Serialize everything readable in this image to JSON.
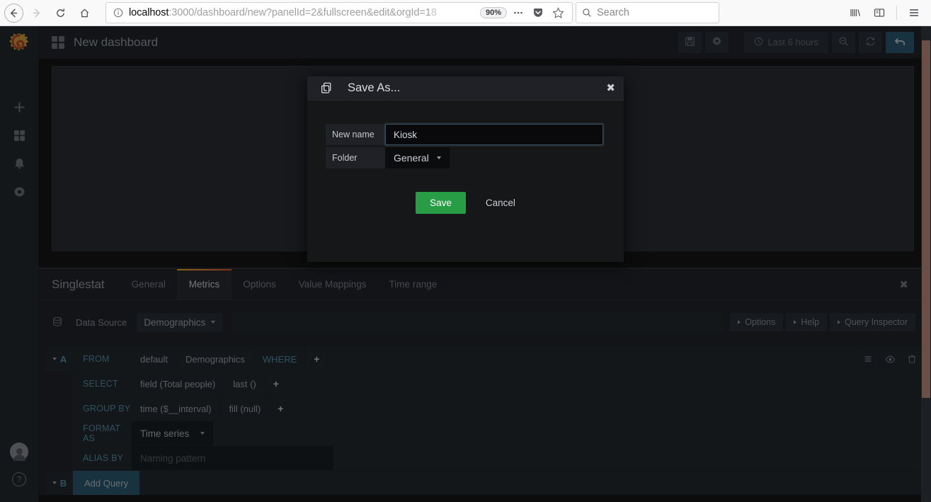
{
  "browser": {
    "nav": {
      "back": "back-arrow",
      "forward": "forward-arrow",
      "reload": "reload",
      "home": "home"
    },
    "url": {
      "host": "localhost",
      "path": ":3000/dashboard/new?panelId=2&fullscreen&edit&orgId=1",
      "faded_tail": "8",
      "info_icon": "info-circle-icon"
    },
    "zoom_level": "90%",
    "search": {
      "placeholder": "Search",
      "icon": "search-icon"
    },
    "icons": {
      "more": "ellipsis-icon",
      "pocket": "pocket-icon",
      "bookmark": "star-icon",
      "library": "library-icon",
      "sidebar": "sidebar-icon",
      "menu": "hamburger-menu-icon"
    }
  },
  "sidebar": {
    "brand": "grafana-logo",
    "items": [
      {
        "name": "create",
        "icon": "plus-icon"
      },
      {
        "name": "dashboards",
        "icon": "apps-grid-icon"
      },
      {
        "name": "alerting",
        "icon": "bell-icon"
      },
      {
        "name": "configuration",
        "icon": "gear-icon"
      }
    ],
    "bottom": [
      {
        "name": "user-profile",
        "icon": "avatar-icon"
      },
      {
        "name": "help",
        "icon": "question-mark-icon"
      }
    ]
  },
  "topnav": {
    "grid_icon": "apps-grid-icon",
    "title": "New dashboard",
    "buttons": [
      {
        "name": "save-dashboard",
        "icon": "floppy-disk-icon",
        "label": ""
      },
      {
        "name": "dashboard-settings",
        "icon": "gear-icon",
        "label": ""
      }
    ],
    "time_picker": {
      "label": "Last 6 hours",
      "icon": "clock-icon"
    },
    "zoom_out": {
      "name": "zoom-out",
      "icon": "magnifier-minus-icon"
    },
    "refresh": {
      "name": "refresh",
      "icon": "refresh-icon"
    },
    "back": {
      "name": "back-to-dashboard",
      "icon": "undo-arrow-icon"
    }
  },
  "editor": {
    "panel_type": "Singlestat",
    "tabs": [
      {
        "label": "General",
        "active": false
      },
      {
        "label": "Metrics",
        "active": true
      },
      {
        "label": "Options",
        "active": false
      },
      {
        "label": "Value Mappings",
        "active": false
      },
      {
        "label": "Time range",
        "active": false
      }
    ],
    "close_icon": "close-icon",
    "datasource": {
      "icon": "database-icon",
      "label": "Data Source",
      "value": "Demographics"
    },
    "right_buttons": [
      {
        "label": "Options"
      },
      {
        "label": "Help"
      },
      {
        "label": "Query Inspector"
      }
    ]
  },
  "query": {
    "ref_id": "A",
    "rows": [
      {
        "key": "FROM",
        "segments": [
          {
            "text": "default",
            "style": "plain"
          },
          {
            "text": "Demographics",
            "style": "plain"
          },
          {
            "text": "WHERE",
            "style": "teal"
          },
          {
            "text": "+",
            "style": "plus"
          }
        ]
      },
      {
        "key": "SELECT",
        "segments": [
          {
            "text": "field (Total people)",
            "style": "plain"
          },
          {
            "text": "last ()",
            "style": "plain"
          },
          {
            "text": "+",
            "style": "plus"
          }
        ]
      },
      {
        "key": "GROUP BY",
        "segments": [
          {
            "text": "time ($__interval)",
            "style": "plain"
          },
          {
            "text": "fill (null)",
            "style": "plain"
          },
          {
            "text": "+",
            "style": "plus"
          }
        ]
      }
    ],
    "format_as": {
      "key": "FORMAT AS",
      "value": "Time series"
    },
    "alias_by": {
      "key": "ALIAS BY",
      "placeholder": "Naming pattern"
    },
    "tools": [
      {
        "name": "query-toggle-text-edit",
        "icon": "hamburger-icon"
      },
      {
        "name": "query-toggle-visibility",
        "icon": "eye-icon"
      },
      {
        "name": "query-delete",
        "icon": "trash-icon"
      }
    ],
    "add_query": {
      "ref_id": "B",
      "label": "Add Query"
    }
  },
  "modal": {
    "icon": "copy-icon",
    "title": "Save As...",
    "close_icon": "close-icon",
    "fields": {
      "name_label": "New name",
      "name_value": "Kiosk",
      "folder_label": "Folder",
      "folder_value": "General"
    },
    "save_label": "Save",
    "cancel_label": "Cancel"
  },
  "colors": {
    "accent_green": "#299c46",
    "accent_blue": "#2f5b73",
    "tab_underline_start": "#f2b827",
    "tab_underline_end": "#eb5b2f",
    "teal_text": "#5a92ab",
    "scrollbar": "#6b4f47"
  }
}
